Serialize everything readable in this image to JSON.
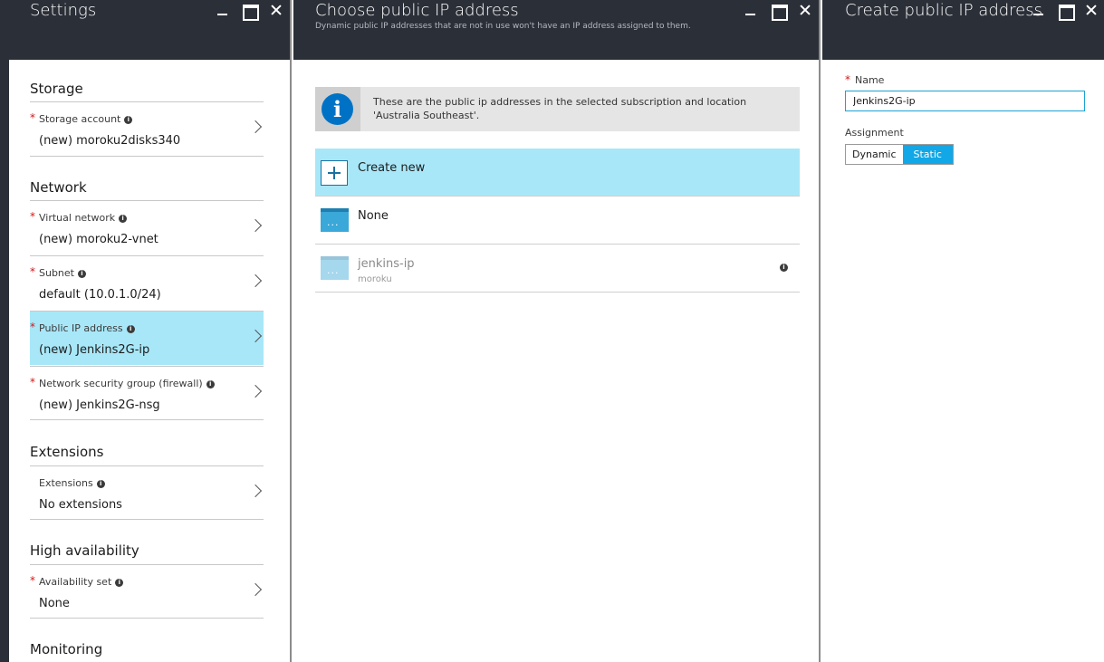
{
  "settings": {
    "title": "Settings",
    "sections": {
      "storage": "Storage",
      "network": "Network",
      "extensions": "Extensions",
      "high_availability": "High availability",
      "monitoring": "Monitoring"
    },
    "rows": {
      "storage_account": {
        "label": "Storage account",
        "value": "(new) moroku2disks340"
      },
      "virtual_network": {
        "label": "Virtual network",
        "value": "(new) moroku2-vnet"
      },
      "subnet": {
        "label": "Subnet",
        "value": "default (10.0.1.0/24)"
      },
      "public_ip": {
        "label": "Public IP address",
        "value": "(new) Jenkins2G-ip"
      },
      "nsg": {
        "label": "Network security group (firewall)",
        "value": "(new) Jenkins2G-nsg"
      },
      "extensions": {
        "label": "Extensions",
        "value": "No extensions"
      },
      "availability_set": {
        "label": "Availability set",
        "value": "None"
      }
    }
  },
  "choose": {
    "title": "Choose public IP address",
    "subtitle": "Dynamic public IP addresses that are not in use won't have an IP address assigned to them.",
    "info_text": "These are the public ip addresses in the selected subscription and location 'Australia Southeast'.",
    "create_new": "Create new",
    "none": "None",
    "existing": {
      "name": "jenkins-ip",
      "resource_group": "moroku"
    }
  },
  "create": {
    "title": "Create public IP address",
    "name_label": "Name",
    "name_value": "Jenkins2G-ip",
    "assignment_label": "Assignment",
    "assignment_options": [
      "Dynamic",
      "Static"
    ],
    "assignment_selected": "Static"
  },
  "colors": {
    "header_bg": "#2b2f38",
    "selected_bg": "#a8e7f8",
    "toggle_on": "#12a7e6",
    "required": "#d01919",
    "info_blue": "#0072c6"
  },
  "icons": {
    "window": [
      "minimize-icon",
      "maximize-icon",
      "close-icon"
    ],
    "row": "chevron-right-icon",
    "info": "info-icon",
    "ip": "public-ip-icon",
    "add": "plus-icon"
  }
}
